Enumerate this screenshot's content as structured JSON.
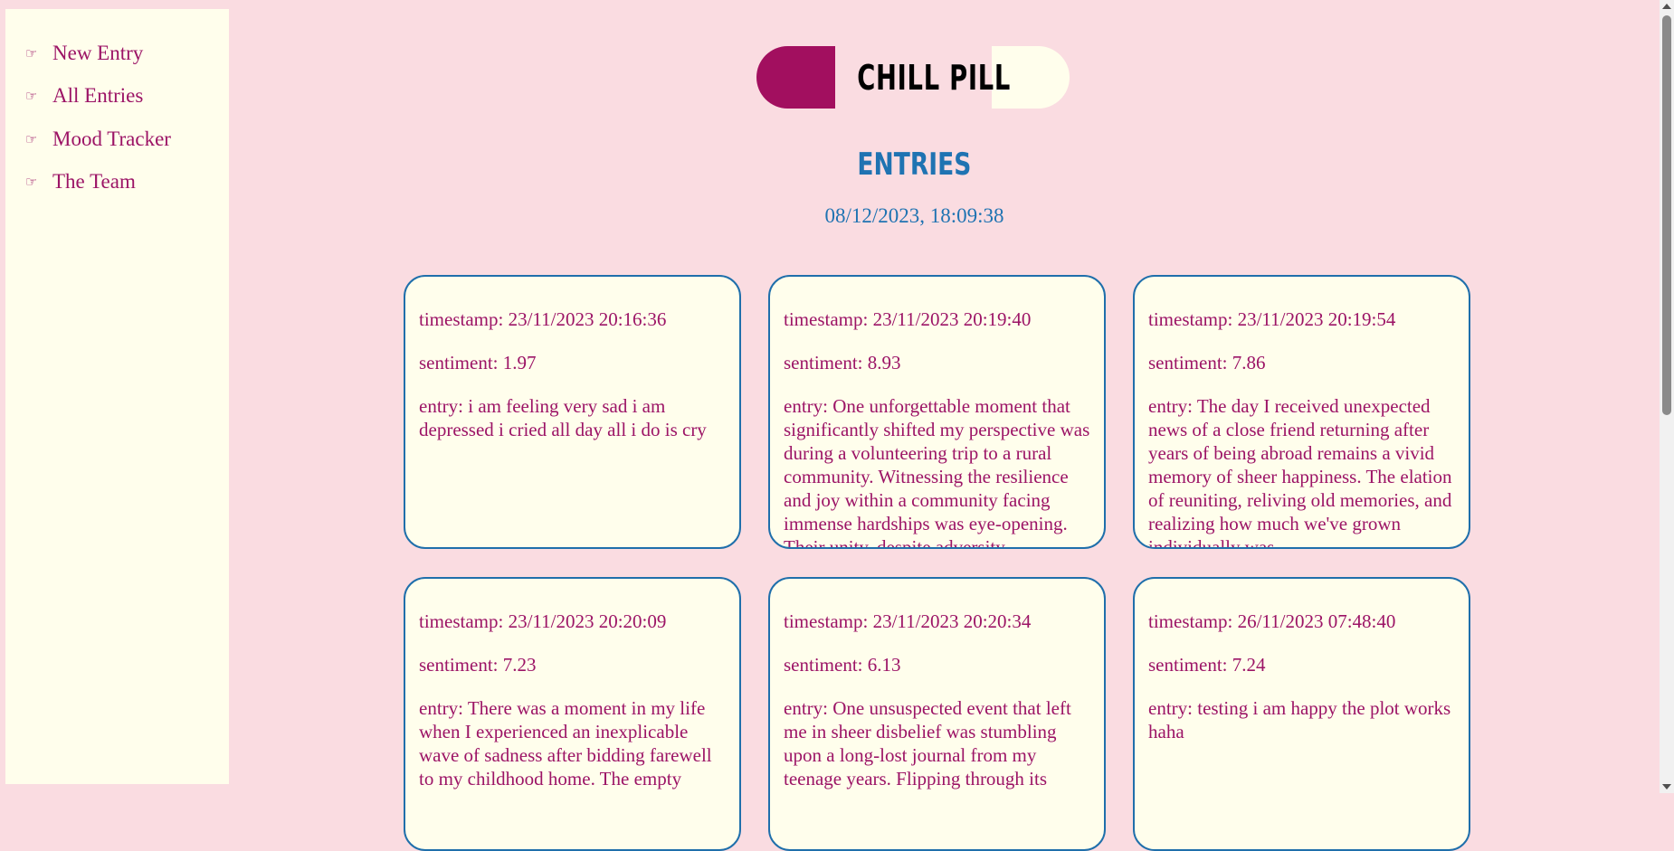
{
  "sidebar": {
    "items": [
      {
        "icon": "☞",
        "label": "New Entry"
      },
      {
        "icon": "☞",
        "label": "All Entries"
      },
      {
        "icon": "☞",
        "label": "Mood Tracker"
      },
      {
        "icon": "☞",
        "label": "The Team"
      }
    ]
  },
  "header": {
    "logo_text": "CHILL PILL",
    "title": "ENTRIES",
    "datetime": "08/12/2023, 18:09:38"
  },
  "entries": [
    {
      "timestamp": "timestamp: 23/11/2023 20:16:36",
      "sentiment": "sentiment: 1.97",
      "entry": "entry: i am feeling very sad i am depressed i cried all day all i do is cry"
    },
    {
      "timestamp": "timestamp: 23/11/2023 20:19:40",
      "sentiment": "sentiment: 8.93",
      "entry": "entry: One unforgettable moment that significantly shifted my perspective was during a volunteering trip to a rural community. Witnessing the resilience and joy within a community facing immense hardships was eye-opening. Their unity, despite adversity"
    },
    {
      "timestamp": "timestamp: 23/11/2023 20:19:54",
      "sentiment": "sentiment: 7.86",
      "entry": "entry: The day I received unexpected news of a close friend returning after years of being abroad remains a vivid memory of sheer happiness. The elation of reuniting, reliving old memories, and realizing how much we've grown individually was"
    },
    {
      "timestamp": "timestamp: 23/11/2023 20:20:09",
      "sentiment": "sentiment: 7.23",
      "entry": "entry: There was a moment in my life when I experienced an inexplicable wave of sadness after bidding farewell to my childhood home. The empty"
    },
    {
      "timestamp": "timestamp: 23/11/2023 20:20:34",
      "sentiment": "sentiment: 6.13",
      "entry": "entry: One unsuspected event that left me in sheer disbelief was stumbling upon a long-lost journal from my teenage years. Flipping through its"
    },
    {
      "timestamp": "timestamp: 26/11/2023 07:48:40",
      "sentiment": "sentiment: 7.24",
      "entry": "entry: testing i am happy the plot works haha"
    }
  ]
}
